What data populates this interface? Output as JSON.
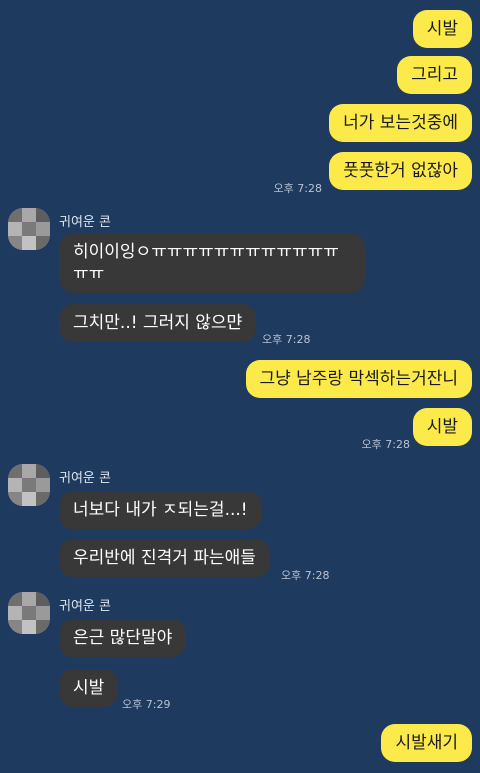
{
  "chat": {
    "colors": {
      "background": "#1e3a5f",
      "outgoing_bubble": "#fce94a",
      "incoming_bubble": "#383838"
    },
    "messages": [
      {
        "dir": "out",
        "text": "시발"
      },
      {
        "dir": "out",
        "text": "그리고"
      },
      {
        "dir": "out",
        "text": "너가 보는것중에"
      },
      {
        "dir": "out",
        "text": "풋풋한거 없잖아",
        "time": "오후 7:28"
      },
      {
        "dir": "in",
        "sender": "귀여운 콘",
        "text": "히이이잉ㅇㅠㅠㅠㅠㅠㅠㅠㅠㅠㅠㅠㅠㅠㅠ"
      },
      {
        "dir": "in",
        "text": "그치만..! 그러지 않으먄",
        "time": "오후 7:28"
      },
      {
        "dir": "out",
        "text": "그냥 남주랑 막섹하는거잔니"
      },
      {
        "dir": "out",
        "text": "시발",
        "time": "오후 7:28"
      },
      {
        "dir": "in",
        "sender": "귀여운 콘",
        "text": "너보다 내가 ㅈ되는걸...!"
      },
      {
        "dir": "in",
        "text": "우리반에 진격거 파는애들",
        "time": "오후 7:28"
      },
      {
        "dir": "in",
        "sender": "귀여운 콘",
        "text": "은근 많단말야"
      },
      {
        "dir": "in",
        "text": "시발",
        "time": "오후 7:29"
      },
      {
        "dir": "out",
        "text": "시발새기"
      }
    ]
  }
}
